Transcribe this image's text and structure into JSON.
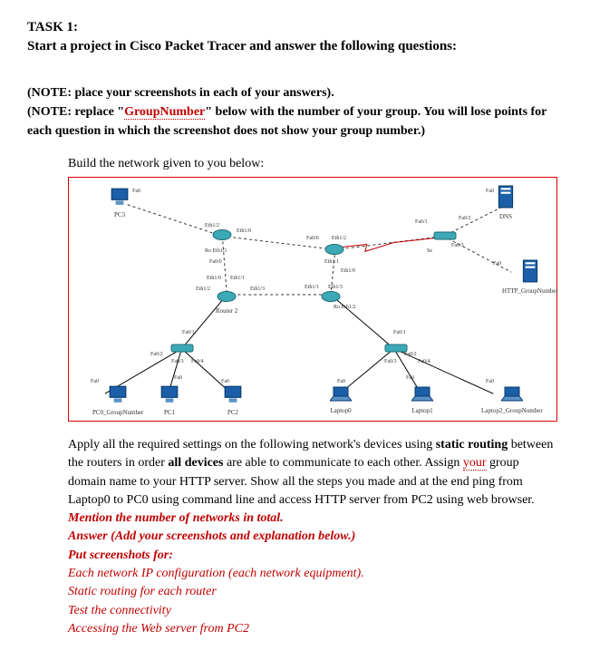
{
  "heading": {
    "task": "TASK 1:",
    "line": "Start a project in Cisco Packet Tracer and answer the following questions:"
  },
  "notes": {
    "note1": "(NOTE: place your screenshots in each of your answers).",
    "note2a": "(NOTE: replace \"",
    "note2_group": "GroupNumber",
    "note2b": "\" below with the number of your group. You will lose points for each question in which the screenshot does not show your group number.)"
  },
  "build": "Build the network given to you below:",
  "diagram": {
    "devices": {
      "pc3": "PC3",
      "dns": "DNS",
      "http": "HTTP_GroupNumber",
      "router2": "Router 2",
      "pc0": "PC0_GroupNumber",
      "pc1": "PC1",
      "pc2": "PC2",
      "laptop0": "Laptop0",
      "laptop1": "Laptop1",
      "laptop2": "Laptop2_GroupNumber"
    },
    "ports": {
      "fa0": "Fa0",
      "fa00": "Fa0/0",
      "fa01": "Fa0/1",
      "fa02": "Fa0/2",
      "fa03": "Fa0/3",
      "fa04": "Fa0/4",
      "eth10": "Eth1/0",
      "eth11": "Eth1/1",
      "eth12": "Eth1/2",
      "eth13": "Eth1/3",
      "se": "Se"
    }
  },
  "instructions": {
    "p1a": "Apply all the required settings on the following network's devices using ",
    "p1b": "static routing",
    "p1c": " between the routers in order ",
    "p1d": "all devices",
    "p1e": " are able to communicate to each other. Assign ",
    "p1_your": "your",
    "p1f": " group domain name to your HTTP server. Show all the steps you made and at the end ping from Laptop0 to PC0 using command line and access HTTP server from PC2 using web browser.",
    "m1": "Mention the number of networks in total.",
    "m2": "Answer (Add your screenshots and explanation below.)",
    "m3": "Put screenshots for:",
    "m4": "Each network IP configuration (each network equipment).",
    "m5": "Static routing for each router",
    "m6": "Test the connectivity",
    "m7": "Accessing the Web server from PC2"
  }
}
